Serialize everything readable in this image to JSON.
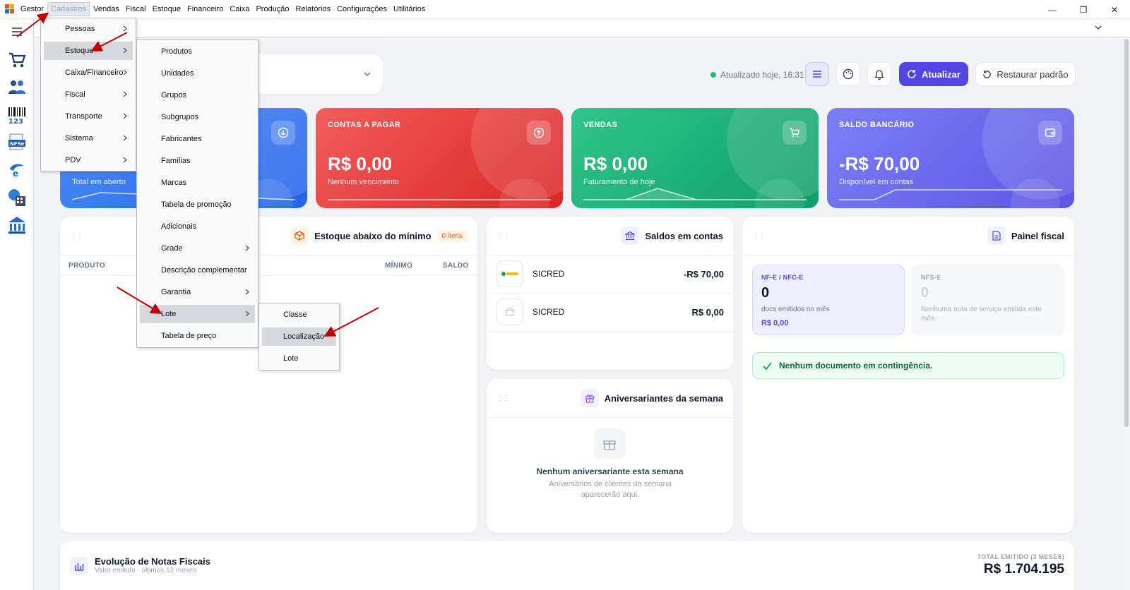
{
  "menubar": {
    "items": [
      "Gestor",
      "Cadastros",
      "Vendas",
      "Fiscal",
      "Estoque",
      "Financeiro",
      "Caixa",
      "Produção",
      "Relatórios",
      "Configurações",
      "Utilitários"
    ]
  },
  "menus": {
    "cadastros": [
      "Pessoas",
      "Estoque",
      "Caixa/Financeiro",
      "Fiscal",
      "Transporte",
      "Sistema",
      "PDV"
    ],
    "estoque": [
      "Produtos",
      "Unidades",
      "Grupos",
      "Subgrupos",
      "Fabricantes",
      "Famílias",
      "Marcas",
      "Tabela de promoção",
      "Adicionais",
      "Grade",
      "Descrição complementar",
      "Garantia",
      "Lote",
      "Tabela de preço"
    ],
    "lote": [
      "Classe",
      "Localização",
      "Lote"
    ]
  },
  "header": {
    "status": "Atualizado hoje, 16:31",
    "update_label": "Atualizar",
    "restore_label": "Restaurar padrão"
  },
  "kpis": {
    "receber": {
      "sub": "Total em aberto"
    },
    "pagar": {
      "label": "CONTAS A PAGAR",
      "value": "R$ 0,00",
      "sub": "Nenhum vencimento"
    },
    "vendas": {
      "label": "VENDAS",
      "value": "R$ 0,00",
      "sub": "Faturamento de hoje"
    },
    "saldo": {
      "label": "SALDO BANCÁRIO",
      "value": "-R$ 70,00",
      "sub": "Disponível em contas"
    }
  },
  "estoque_panel": {
    "title": "Estoque abaixo do mínimo",
    "badge": "0 itens",
    "columns": [
      "PRODUTO",
      "MÍNIMO",
      "SALDO"
    ]
  },
  "saldos_panel": {
    "title": "Saldos em contas",
    "accounts": [
      {
        "name": "SICRED",
        "value": "-R$ 70,00"
      },
      {
        "name": "SICRED",
        "value": "R$ 0,00"
      }
    ]
  },
  "aniversariantes_panel": {
    "title": "Aniversariantes da semana",
    "empty_title": "Nenhum aniversariante esta semana",
    "empty_sub": "Aniversários de clientes da semana aparecerão aqui."
  },
  "fiscal_panel": {
    "title": "Painel fiscal",
    "nfe": {
      "label": "NF-E / NFC-E",
      "value": "0",
      "sub": "docs emitidos no mês",
      "money": "R$ 0,00"
    },
    "nfse": {
      "label": "NFS-E",
      "value": "0",
      "sub": "Nenhuma nota de serviço emitida este mês."
    },
    "contingencia": "Nenhum documento em contingência."
  },
  "evolucao_panel": {
    "title": "Evolução de Notas Fiscais",
    "sub": "Valor emitido · últimos 12 meses",
    "total_label": "TOTAL EMITIDO (3 MESES)",
    "total_value": "R$ 1.704.195"
  },
  "colors": {
    "accent": "#4f46e5",
    "receber": "#2563eb",
    "pagar": "#dc2626",
    "vendas": "#0f9f6c",
    "saldo": "#5b57e4",
    "annotation": "#c00000"
  }
}
